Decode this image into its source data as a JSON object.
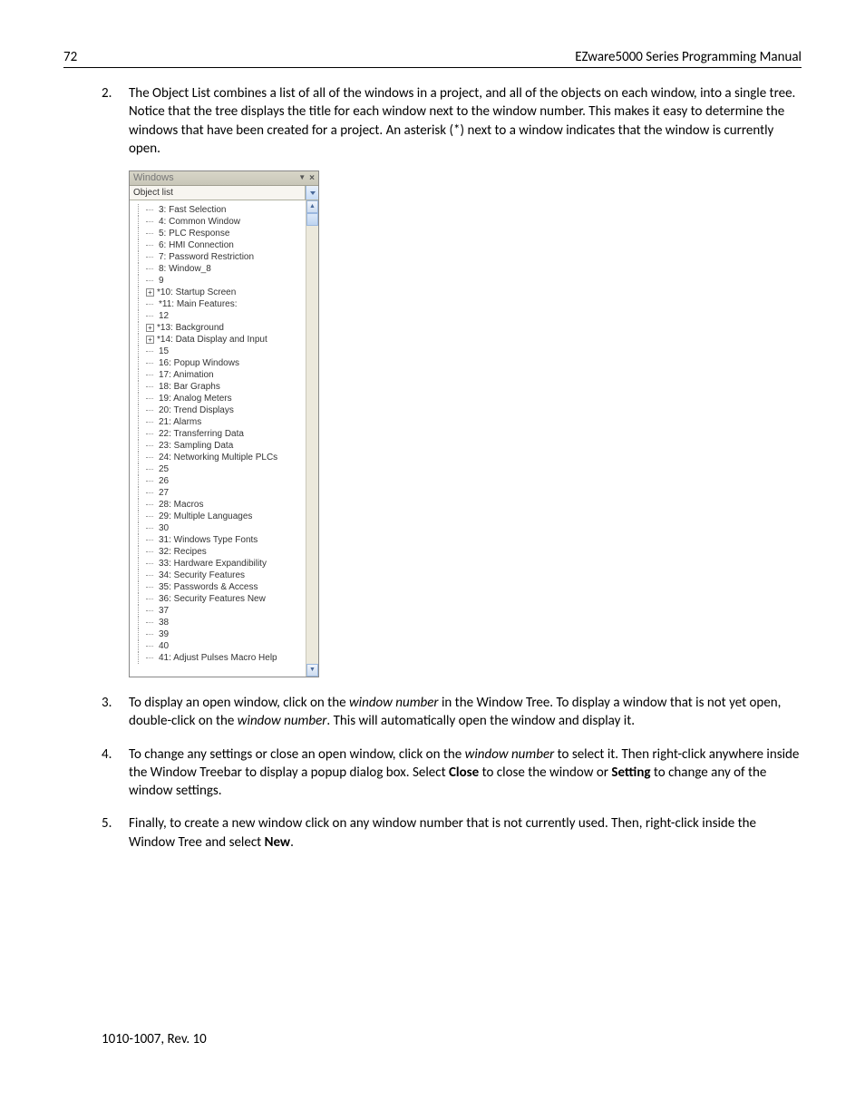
{
  "header": {
    "page_number": "72",
    "title": "EZware5000 Series Programming Manual"
  },
  "paragraphs": {
    "p2_num": "2.",
    "p2": "The Object List combines a list of all of the windows in a project, and all of the objects on each window, into a single tree. Notice that the tree displays the title for each window next to the window number. This makes it easy to determine the windows that have been created for a project. An asterisk (*) next to a window indicates that the window is currently open.",
    "p3_num": "3.",
    "p3a": "To display an open window, click on the ",
    "p3b": "window number",
    "p3c": " in the Window Tree. To display a window that is not yet open, double-click on the ",
    "p3d": "window number",
    "p3e": ". This will automatically open the window and display it.",
    "p4_num": "4.",
    "p4a": "To change any settings or close an open window, click on the ",
    "p4b": "window number",
    "p4c": " to select it. Then right-click anywhere inside the Window Treebar to display a popup dialog box. Select ",
    "p4d": "Close",
    "p4e": " to close the window or ",
    "p4f": "Setting",
    "p4g": " to change any of the window settings.",
    "p5_num": "5.",
    "p5a": "Finally, to create a new window click on any window number that is not currently used. Then, right-click inside the Window Tree and select ",
    "p5b": "New",
    "p5c": "."
  },
  "panel": {
    "title": "Windows",
    "dropdown": "Object list",
    "items": [
      {
        "indent": 1,
        "expand": "",
        "label": "3: Fast Selection"
      },
      {
        "indent": 1,
        "expand": "",
        "label": "4: Common Window"
      },
      {
        "indent": 1,
        "expand": "",
        "label": "5: PLC Response"
      },
      {
        "indent": 1,
        "expand": "",
        "label": "6: HMI Connection"
      },
      {
        "indent": 1,
        "expand": "",
        "label": "7: Password Restriction"
      },
      {
        "indent": 1,
        "expand": "",
        "label": "8: Window_8"
      },
      {
        "indent": 1,
        "expand": "",
        "label": "9"
      },
      {
        "indent": 0,
        "expand": "+",
        "label": "*10: Startup Screen"
      },
      {
        "indent": 1,
        "expand": "",
        "label": "*11: Main Features:"
      },
      {
        "indent": 1,
        "expand": "",
        "label": "12"
      },
      {
        "indent": 0,
        "expand": "+",
        "label": "*13: Background"
      },
      {
        "indent": 0,
        "expand": "+",
        "label": "*14: Data Display and Input"
      },
      {
        "indent": 1,
        "expand": "",
        "label": "15"
      },
      {
        "indent": 1,
        "expand": "",
        "label": "16: Popup Windows"
      },
      {
        "indent": 1,
        "expand": "",
        "label": "17: Animation"
      },
      {
        "indent": 1,
        "expand": "",
        "label": "18: Bar Graphs"
      },
      {
        "indent": 1,
        "expand": "",
        "label": "19: Analog Meters"
      },
      {
        "indent": 1,
        "expand": "",
        "label": "20: Trend Displays"
      },
      {
        "indent": 1,
        "expand": "",
        "label": "21: Alarms"
      },
      {
        "indent": 1,
        "expand": "",
        "label": "22: Transferring Data"
      },
      {
        "indent": 1,
        "expand": "",
        "label": "23: Sampling Data"
      },
      {
        "indent": 1,
        "expand": "",
        "label": "24: Networking Multiple PLCs"
      },
      {
        "indent": 1,
        "expand": "",
        "label": "25"
      },
      {
        "indent": 1,
        "expand": "",
        "label": "26"
      },
      {
        "indent": 1,
        "expand": "",
        "label": "27"
      },
      {
        "indent": 1,
        "expand": "",
        "label": "28: Macros"
      },
      {
        "indent": 1,
        "expand": "",
        "label": "29: Multiple Languages"
      },
      {
        "indent": 1,
        "expand": "",
        "label": "30"
      },
      {
        "indent": 1,
        "expand": "",
        "label": "31: Windows Type Fonts"
      },
      {
        "indent": 1,
        "expand": "",
        "label": "32: Recipes"
      },
      {
        "indent": 1,
        "expand": "",
        "label": "33: Hardware Expandibility"
      },
      {
        "indent": 1,
        "expand": "",
        "label": "34: Security Features"
      },
      {
        "indent": 1,
        "expand": "",
        "label": "35: Passwords & Access"
      },
      {
        "indent": 1,
        "expand": "",
        "label": "36: Security Features New"
      },
      {
        "indent": 1,
        "expand": "",
        "label": "37"
      },
      {
        "indent": 1,
        "expand": "",
        "label": "38"
      },
      {
        "indent": 1,
        "expand": "",
        "label": "39"
      },
      {
        "indent": 1,
        "expand": "",
        "label": "40"
      },
      {
        "indent": 1,
        "expand": "",
        "label": "41: Adjust Pulses Macro Help"
      }
    ]
  },
  "footer": "1010-1007, Rev. 10"
}
